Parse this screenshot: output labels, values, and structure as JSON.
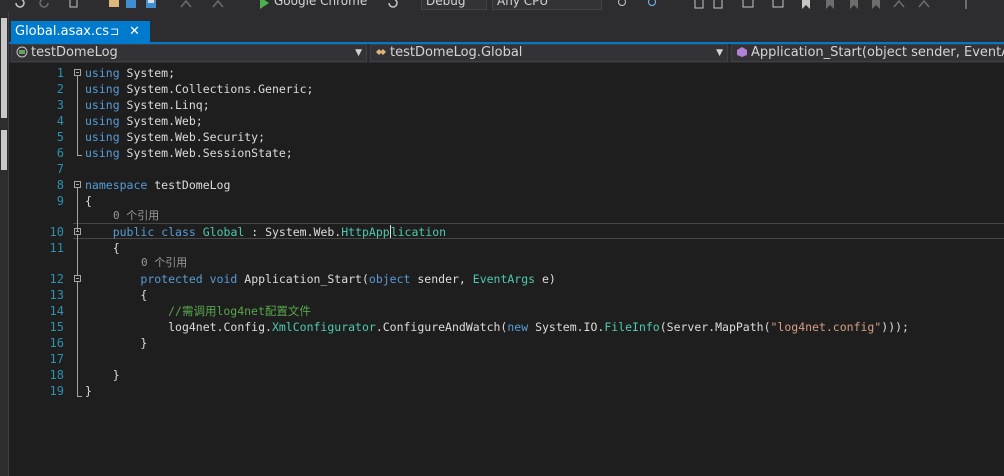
{
  "toolbar": {
    "browser": "Google Chrome",
    "config": "Debug",
    "platform": "Any CPU"
  },
  "tab": {
    "title": "Global.asax.cs",
    "pin": "⊐",
    "close": "✕"
  },
  "nav": {
    "project": "testDomeLog",
    "class": "testDomeLog.Global",
    "member": "Application_Start(object sender, EventArgs e)"
  },
  "editor": {
    "line_numbers": [
      "1",
      "2",
      "3",
      "4",
      "5",
      "6",
      "7",
      "8",
      "9",
      "10",
      "11",
      "12",
      "13",
      "14",
      "15",
      "16",
      "17",
      "18",
      "19"
    ],
    "hint_class": "0 个引用",
    "hint_method": "0 个引用",
    "l1": {
      "kw": "using",
      "rest": " System;"
    },
    "l2": {
      "kw": "using",
      "rest": " System.Collections.Generic;"
    },
    "l3": {
      "kw": "using",
      "rest": " System.Linq;"
    },
    "l4": {
      "kw": "using",
      "rest": " System.Web;"
    },
    "l5": {
      "kw": "using",
      "rest": " System.Web.Security;"
    },
    "l6": {
      "kw": "using",
      "rest": " System.Web.SessionState;"
    },
    "l8": {
      "kw": "namespace",
      "rest": " testDomeLog"
    },
    "l9": "{",
    "l10": {
      "kw1": "public",
      "kw2": "class",
      "type": "Global",
      "mid": " : System.Web.",
      "base_a": "HttpApp",
      "base_b": "lication"
    },
    "l11": "{",
    "l12": {
      "kw1": "protected",
      "kw2": "void",
      "name": " Application_Start(",
      "kw3": "object",
      "mid": " sender, ",
      "type": "EventArgs",
      "end": " e)"
    },
    "l13": "{",
    "l14": "//需调用log4net配置文件",
    "l15": {
      "a": "log4net.Config.",
      "t1": "XmlConfigurator",
      "b": ".ConfigureAndWatch(",
      "kw": "new",
      "c": " System.IO.",
      "t2": "FileInfo",
      "d": "(Server.MapPath(",
      "s": "\"log4net.config\"",
      "e": ")));"
    },
    "l16": "}",
    "l18": "}",
    "l19": "}"
  },
  "colors": {
    "accent": "#007acc",
    "keyword": "#569cd6",
    "type": "#4ec9b0",
    "string": "#d69d85",
    "comment": "#57a64a",
    "line_number": "#2b91af"
  }
}
